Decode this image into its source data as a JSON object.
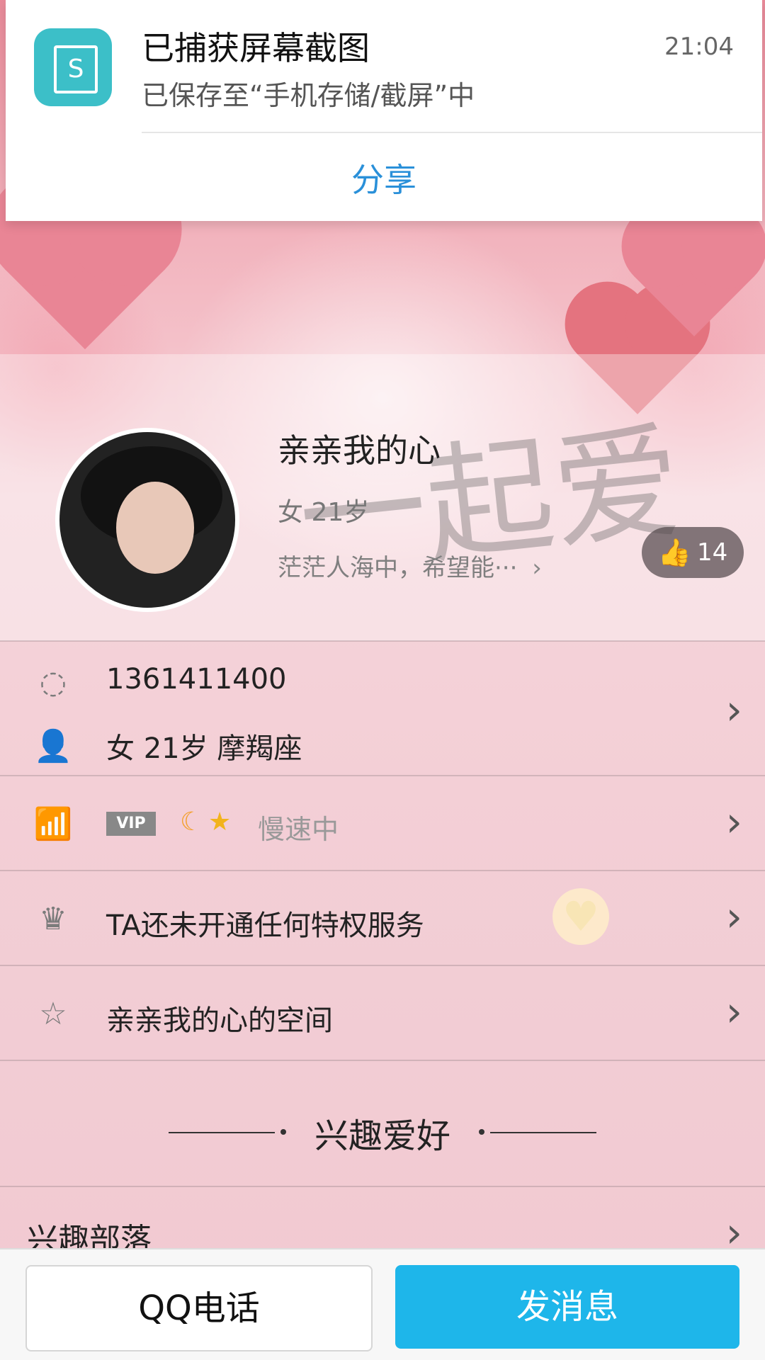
{
  "notification": {
    "title": "已捕获屏幕截图",
    "time": "21:04",
    "description": "已保存至“手机存储/截屏”中",
    "share_label": "分享",
    "icon": "screenshot-app-icon"
  },
  "profile": {
    "nickname": "亲亲我的心",
    "sub_info": "女 21岁",
    "signature": "茫茫人海中，希望能···",
    "watermark": "一起爱",
    "likes": "14"
  },
  "rows": {
    "qq_number": "1361411400",
    "basic_info": "女   21岁   摩羯座",
    "vip_label": "VIP",
    "level_status": "慢速中",
    "privilege": "TA还未开通任何特权服务",
    "space": "亲亲我的心的空间"
  },
  "section": {
    "title": "兴趣爱好",
    "interest_row": "兴趣部落"
  },
  "bottom": {
    "call_label": "QQ电话",
    "message_label": "发消息"
  },
  "colors": {
    "share_blue": "#2a90d9",
    "message_button": "#1eb6ea",
    "notification_icon": "#3cbfc8"
  }
}
